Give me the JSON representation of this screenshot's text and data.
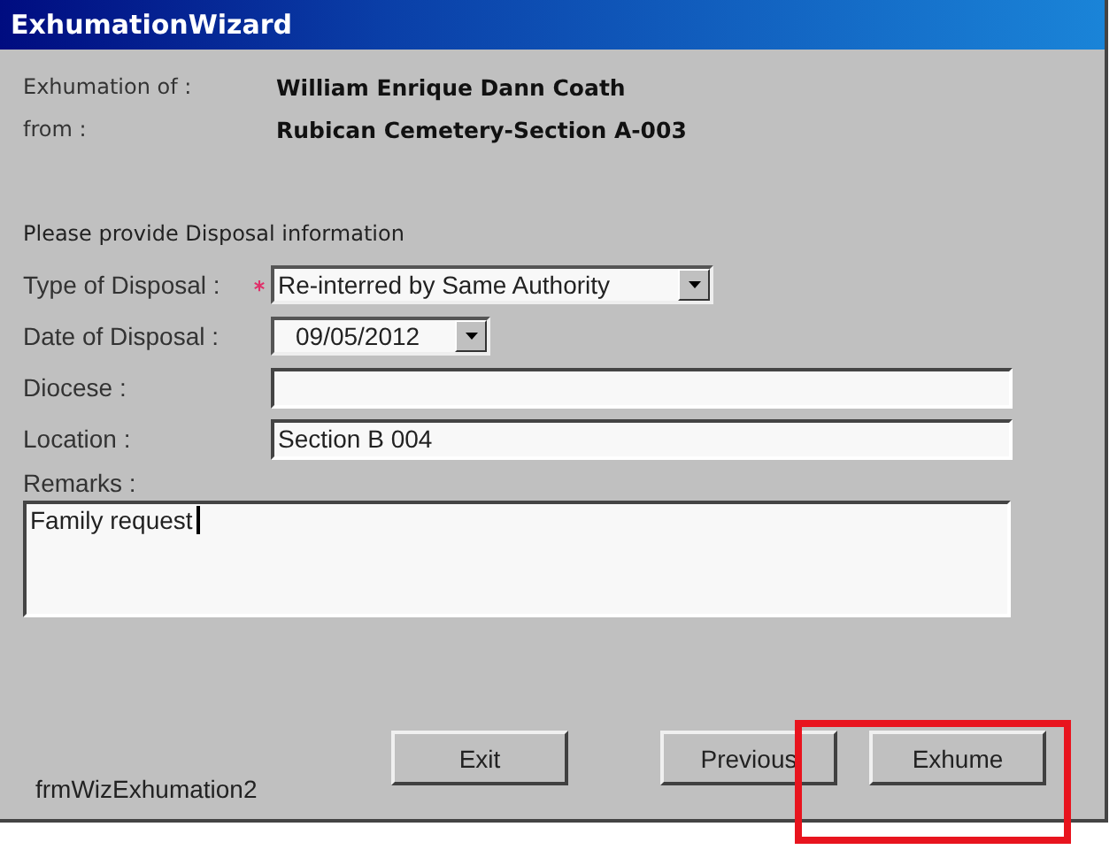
{
  "window": {
    "title": "ExhumationWizard"
  },
  "summary": [
    {
      "label": "Exhumation of :",
      "value": "William Enrique Dann Coath"
    },
    {
      "label": "from :",
      "value": "Rubican Cemetery-Section A-003"
    }
  ],
  "instruction": "Please provide Disposal information",
  "fields": [
    {
      "kind": "dropdown",
      "label": "Type of Disposal :",
      "required": true,
      "value": "Re-interred by Same Authority"
    },
    {
      "kind": "date",
      "label": "Date of Disposal :",
      "required": false,
      "value": "09/05/2012"
    },
    {
      "kind": "text",
      "label": "Diocese :",
      "required": false
    },
    {
      "kind": "text",
      "label": "Location :",
      "required": false,
      "value": "Section B 004"
    }
  ],
  "remarks": {
    "label": "Remarks :",
    "value": "Family request",
    "focused": true
  },
  "form_name": "frmWizExhumation2",
  "buttons": [
    {
      "label": "Exit"
    },
    {
      "label": "Previous"
    },
    {
      "label": "Exhume"
    }
  ],
  "annotation": {
    "kind": "highlight-box"
  }
}
